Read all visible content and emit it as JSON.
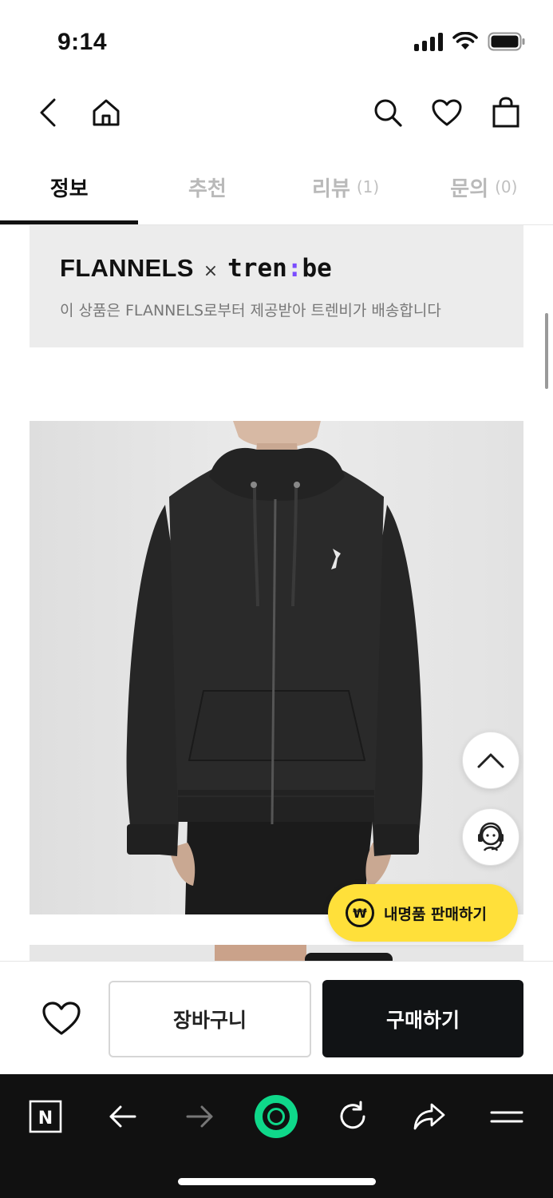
{
  "status_bar": {
    "time": "9:14"
  },
  "tabs": [
    {
      "label": "정보",
      "count": ""
    },
    {
      "label": "추천",
      "count": ""
    },
    {
      "label": "리뷰",
      "count": "(1)"
    },
    {
      "label": "문의",
      "count": "(0)"
    }
  ],
  "partner_banner": {
    "brand": "FLANNELS",
    "separator": "×",
    "partner_pre": "tren",
    "partner_colon": ":",
    "partner_post": "be",
    "description": "이 상품은 FLANNELS로부터 제공받아 트렌비가 배송합니다"
  },
  "sell_button": {
    "icon_text": "₩",
    "label": "내명품 판매하기"
  },
  "actions": {
    "cart_label": "장바구니",
    "buy_label": "구매하기"
  },
  "browser": {
    "n_label": "N"
  },
  "icons": {
    "back": "chevron-left-icon",
    "home": "home-icon",
    "search": "search-icon",
    "wishlist": "heart-icon",
    "bag": "shopping-bag-icon",
    "scroll_top": "chevron-up-icon",
    "support": "headset-agent-icon"
  },
  "colors": {
    "accent": "#7a4cff",
    "sell_pill": "#ffe03a",
    "buy_button": "#111315",
    "active_tab": "#111111"
  }
}
